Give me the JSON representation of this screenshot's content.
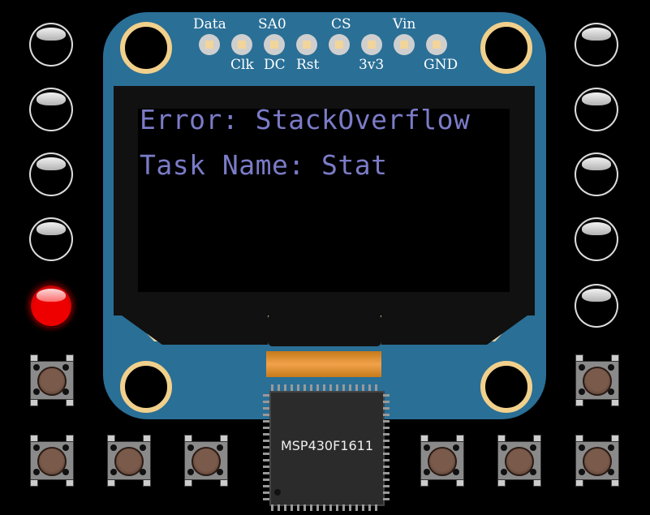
{
  "pins": {
    "top_labels": [
      "Data",
      "SA0",
      "CS",
      "Vin"
    ],
    "bottom_labels": [
      "Clk",
      "DC",
      "Rst",
      "3v3",
      "GND"
    ]
  },
  "display": {
    "line1": "Error: StackOverflow",
    "line2": "Task Name: Stat"
  },
  "chip": {
    "label": "MSP430F1611"
  },
  "leds": {
    "left": [
      "off",
      "off",
      "off",
      "off",
      "on"
    ],
    "right": [
      "off",
      "off",
      "off",
      "off",
      "off"
    ],
    "on_color": "#e00000"
  },
  "colors": {
    "board": "#2a6f96",
    "oled_text": "#7b7bc8",
    "hole_ring": "#f1d08c"
  }
}
